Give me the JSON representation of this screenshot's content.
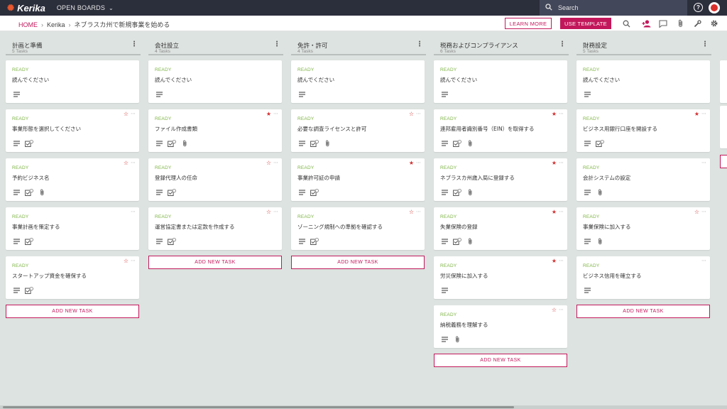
{
  "app": {
    "logo_text": "Kerika",
    "open_boards_label": "OPEN BOARDS",
    "search_placeholder": "Search",
    "help_label": "?"
  },
  "breadcrumb": {
    "home": "HOME",
    "workspace": "Kerika",
    "board": "ネブラスカ州で新規事業を始める"
  },
  "toolbar": {
    "learn_more_label": "LEARN MORE",
    "use_template_label": "USE TEMPLATE"
  },
  "colors": {
    "accent": "#c2185b",
    "ready": "#7cb342",
    "topbar": "#2b2e3b",
    "board_bg": "#dde3e0"
  },
  "add_task_label": "ADD NEW TASK",
  "columns": [
    {
      "title": "計画と準備",
      "count": "5 Tasks",
      "cards": [
        {
          "status": "READY",
          "title": "読んでください",
          "star": "none",
          "icons": [
            "desc"
          ]
        },
        {
          "status": "READY",
          "title": "事業形態を選択してください",
          "star": "outline",
          "icons": [
            "desc",
            "check"
          ]
        },
        {
          "status": "READY",
          "title": "予約ビジネス名",
          "star": "outline",
          "icons": [
            "desc",
            "check",
            "clip"
          ]
        },
        {
          "status": "READY",
          "title": "事業計画を策定する",
          "star": "none",
          "icons": [
            "desc",
            "check"
          ]
        },
        {
          "status": "READY",
          "title": "スタートアップ資金を確保する",
          "star": "outline",
          "icons": [
            "desc",
            "check"
          ]
        }
      ]
    },
    {
      "title": "会社設立",
      "count": "4 Tasks",
      "cards": [
        {
          "status": "READY",
          "title": "読んでください",
          "star": "none",
          "icons": [
            "desc"
          ]
        },
        {
          "status": "READY",
          "title": "ファイル作成書類",
          "star": "filled",
          "icons": [
            "desc",
            "check",
            "clip"
          ]
        },
        {
          "status": "READY",
          "title": "登録代理人の任命",
          "star": "outline",
          "icons": [
            "desc",
            "check"
          ]
        },
        {
          "status": "READY",
          "title": "運営協定書または定款を作成する",
          "star": "outline",
          "icons": [
            "desc",
            "check"
          ]
        }
      ]
    },
    {
      "title": "免許・許可",
      "count": "4 Tasks",
      "cards": [
        {
          "status": "READY",
          "title": "読んでください",
          "star": "none",
          "icons": [
            "desc"
          ]
        },
        {
          "status": "READY",
          "title": "必要な調査ライセンスと許可",
          "star": "outline",
          "icons": [
            "desc",
            "check",
            "clip"
          ]
        },
        {
          "status": "READY",
          "title": "事業許可証の申請",
          "star": "filled",
          "icons": [
            "desc",
            "check"
          ]
        },
        {
          "status": "READY",
          "title": "ゾーニング規制への準拠を確認する",
          "star": "outline",
          "icons": [
            "desc",
            "check"
          ]
        }
      ]
    },
    {
      "title": "税務およびコンプライアンス",
      "count": "6 Tasks",
      "cards": [
        {
          "status": "READY",
          "title": "読んでください",
          "star": "none",
          "icons": [
            "desc"
          ]
        },
        {
          "status": "READY",
          "title": "連邦雇用者識別番号（EIN）を取得する",
          "star": "filled",
          "icons": [
            "desc",
            "check",
            "clip"
          ]
        },
        {
          "status": "READY",
          "title": "ネブラスカ州歳入局に登録する",
          "star": "filled",
          "icons": [
            "desc",
            "check",
            "clip"
          ]
        },
        {
          "status": "READY",
          "title": "失業保険の登録",
          "star": "filled",
          "icons": [
            "desc",
            "check",
            "clip"
          ]
        },
        {
          "status": "READY",
          "title": "労災保険に加入する",
          "star": "filled",
          "icons": [
            "desc"
          ]
        },
        {
          "status": "READY",
          "title": "納税義務を理解する",
          "star": "outline",
          "icons": [
            "desc",
            "clip"
          ]
        }
      ]
    },
    {
      "title": "財務設定",
      "count": "5 Tasks",
      "cards": [
        {
          "status": "READY",
          "title": "読んでください",
          "star": "none",
          "icons": [
            "desc"
          ]
        },
        {
          "status": "READY",
          "title": "ビジネス用銀行口座を開設する",
          "star": "filled",
          "icons": [
            "desc",
            "check"
          ]
        },
        {
          "status": "READY",
          "title": "会計システムの設定",
          "star": "none",
          "icons": [
            "desc",
            "clip"
          ]
        },
        {
          "status": "READY",
          "title": "事業保険に加入する",
          "star": "outline",
          "icons": [
            "desc",
            "clip"
          ]
        },
        {
          "status": "READY",
          "title": "ビジネス信用を確立する",
          "star": "none",
          "icons": [
            "desc"
          ]
        }
      ]
    }
  ]
}
